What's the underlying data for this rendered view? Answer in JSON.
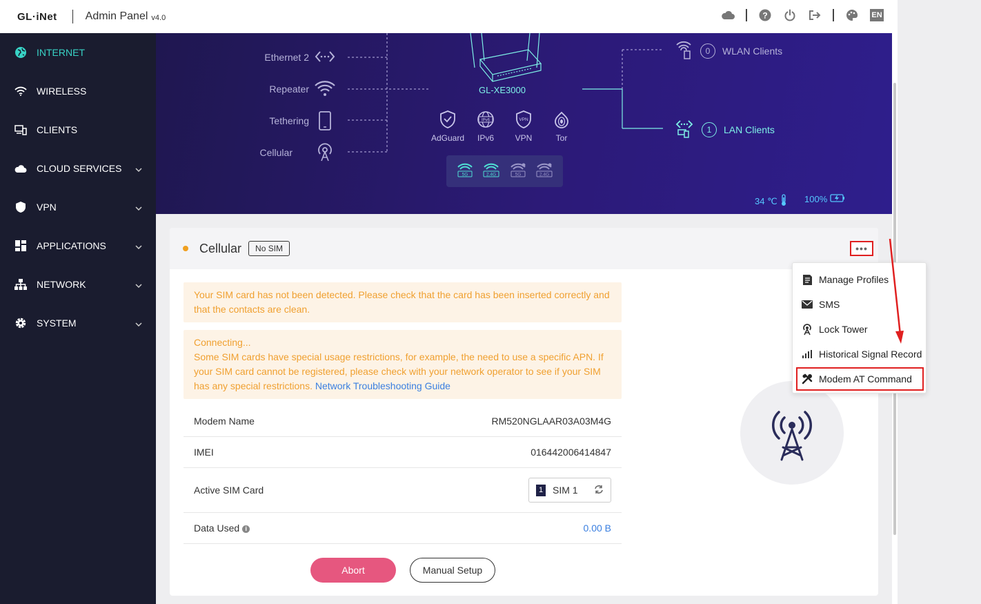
{
  "header": {
    "logo": "GL·iNet",
    "title": "Admin Panel",
    "version": "v4.0",
    "lang": "EN",
    "icons": [
      "cloud-icon",
      "help-icon",
      "power-icon",
      "logout-icon",
      "theme-icon"
    ]
  },
  "sidebar": {
    "items": [
      {
        "label": "INTERNET",
        "icon": "globe-icon",
        "active": true
      },
      {
        "label": "WIRELESS",
        "icon": "wifi-icon"
      },
      {
        "label": "CLIENTS",
        "icon": "clients-icon"
      },
      {
        "label": "CLOUD SERVICES",
        "icon": "cloud-icon",
        "expandable": true
      },
      {
        "label": "VPN",
        "icon": "shield-icon",
        "expandable": true
      },
      {
        "label": "APPLICATIONS",
        "icon": "apps-icon",
        "expandable": true
      },
      {
        "label": "NETWORK",
        "icon": "network-icon",
        "expandable": true
      },
      {
        "label": "SYSTEM",
        "icon": "gear-icon",
        "expandable": true
      }
    ]
  },
  "hero": {
    "connections": [
      "Ethernet 2",
      "Repeater",
      "Tethering",
      "Cellular"
    ],
    "device_name": "GL-XE3000",
    "features": [
      "AdGuard",
      "IPv6",
      "VPN",
      "Tor"
    ],
    "wifi_bands": [
      "5G",
      "2.4G",
      "5G",
      "2.4G"
    ],
    "wlan_clients_count": "0",
    "wlan_clients_label": "WLAN Clients",
    "lan_clients_count": "1",
    "lan_clients_label": "LAN Clients",
    "temperature": "34 ℃",
    "battery": "100%"
  },
  "cellular": {
    "title": "Cellular",
    "badge": "No SIM",
    "alert_sim": "Your SIM card has not been detected. Please check that the card has been inserted correctly and that the contacts are clean.",
    "alert_connecting_title": "Connecting...",
    "alert_connecting_body": "Some SIM cards have special usage restrictions, for example, the need to use a specific APN. If your SIM card cannot be registered, please check with your network operator to see if your SIM has any special restrictions.",
    "alert_link": "Network Troubleshooting Guide",
    "modem_name_label": "Modem Name",
    "modem_name_value": "RM520NGLAAR03A03M4G",
    "imei_label": "IMEI",
    "imei_value": "016442006414847",
    "active_sim_label": "Active SIM Card",
    "sim_number": "1",
    "sim_value": "SIM 1",
    "data_used_label": "Data Used",
    "data_used_value": "0.00 B",
    "abort_button": "Abort",
    "manual_button": "Manual Setup"
  },
  "menu": {
    "items": [
      {
        "label": "Manage Profiles",
        "icon": "profile-icon"
      },
      {
        "label": "SMS",
        "icon": "envelope-icon"
      },
      {
        "label": "Lock Tower",
        "icon": "tower-icon"
      },
      {
        "label": "Historical Signal Record",
        "icon": "signal-bars-icon"
      },
      {
        "label": "Modem AT Command",
        "icon": "tools-icon",
        "highlighted": true
      }
    ]
  },
  "colors": {
    "sidebar_bg": "#1a1c2f",
    "active_accent": "#38d3c6",
    "alert_text": "#f0a030",
    "abort_button": "#e6577f",
    "highlight_red": "#e02020"
  }
}
